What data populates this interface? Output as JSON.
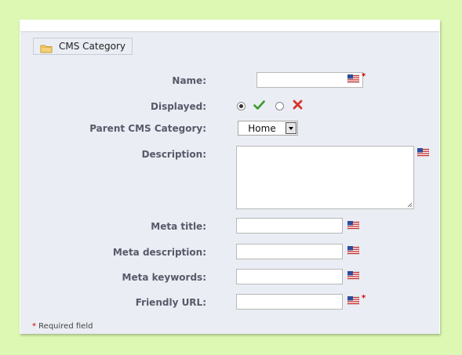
{
  "panel": {
    "legend": "CMS Category",
    "icon": "folder-icon"
  },
  "form": {
    "name_label": "Name:",
    "name_value": "",
    "displayed_label": "Displayed:",
    "displayed_value": "yes",
    "parent_label": "Parent CMS Category:",
    "parent_value": "Home",
    "description_label": "Description:",
    "description_value": "",
    "meta_title_label": "Meta title:",
    "meta_title_value": "",
    "meta_description_label": "Meta description:",
    "meta_description_value": "",
    "meta_keywords_label": "Meta keywords:",
    "meta_keywords_value": "",
    "friendly_url_label": "Friendly URL:",
    "friendly_url_value": "",
    "required_marker": "*",
    "language_flag": "us-flag-icon"
  },
  "footer": {
    "star": "*",
    "required_text": " Required field"
  },
  "colors": {
    "background": "#dcf8b3",
    "fieldset": "#eaedf4",
    "label": "#585a69",
    "required": "#cc0000",
    "check": "#3a9a2a",
    "cross": "#d9342b"
  }
}
